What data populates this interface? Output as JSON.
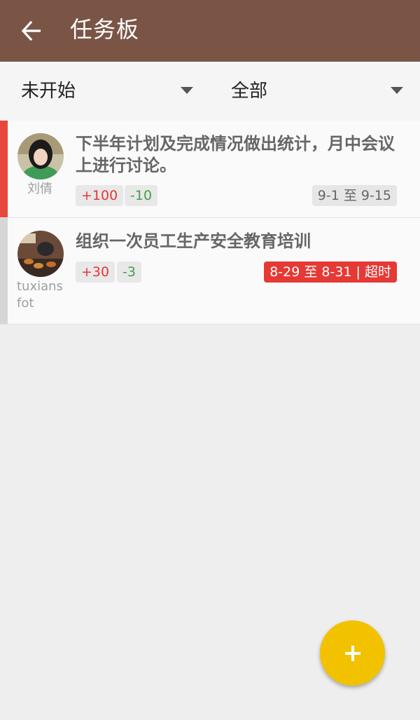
{
  "header": {
    "title": "任务板",
    "back_icon": "arrow-left-icon"
  },
  "filters": {
    "status": {
      "selected": "未开始"
    },
    "scope": {
      "selected": "全部"
    }
  },
  "tasks": [
    {
      "title": "下半年计划及完成情况做出统计，月中会议上进行讨论。",
      "user": "刘倩",
      "reward": "+100",
      "penalty": "-10",
      "date": "9-1 至 9-15",
      "stripe_color": "#e8473b"
    },
    {
      "title": "组织一次员工生产安全教育培训",
      "user": "tuxiansfot",
      "reward": "+30",
      "penalty": "-3",
      "date": "8-29 至 8-31 | 超时",
      "stripe_color": "#d6d6d6"
    }
  ],
  "fab": {
    "icon": "plus-icon"
  },
  "colors": {
    "appbar": "#7a5546",
    "fab": "#f2c200",
    "reward": "#e53935",
    "penalty": "#43a047",
    "overdue": "#e53935"
  }
}
